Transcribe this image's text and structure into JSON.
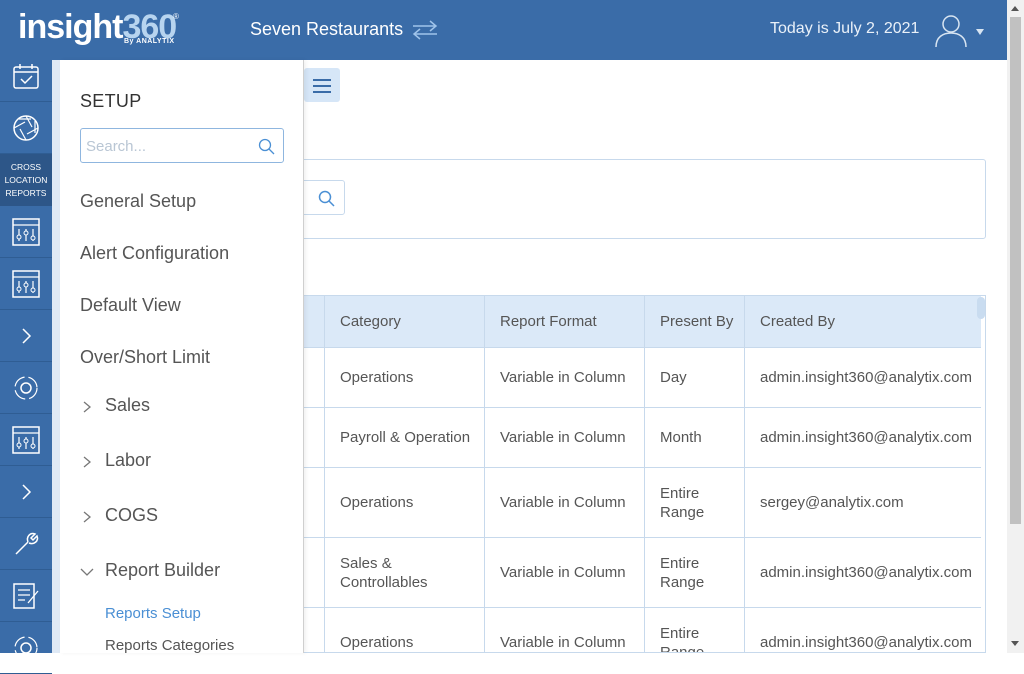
{
  "header": {
    "logo_word": "insight",
    "logo_num": "360",
    "logo_reg": "®",
    "logo_by": "By ANALYTIX",
    "org_name": "Seven Restaurants",
    "today": "Today is July 2, 2021"
  },
  "rail": {
    "cross_location": "CROSS LOCATION REPORTS"
  },
  "setup": {
    "title": "SETUP",
    "search_placeholder": "Search...",
    "items": [
      "General Setup",
      "Alert Configuration",
      "Default View",
      "Over/Short Limit"
    ],
    "groups": [
      {
        "label": "Sales",
        "expanded": false
      },
      {
        "label": "Labor",
        "expanded": false
      },
      {
        "label": "COGS",
        "expanded": false
      },
      {
        "label": "Report Builder",
        "expanded": true
      }
    ],
    "report_builder_items": [
      {
        "label": "Reports Setup",
        "active": true
      },
      {
        "label": "Reports Categories",
        "active": false
      }
    ]
  },
  "table": {
    "headers": [
      "Category",
      "Report Format",
      "Present By",
      "Created By"
    ],
    "rows": [
      [
        "Operations",
        "Variable in Column",
        "Day",
        "admin.insight360@analytix.com"
      ],
      [
        "Payroll & Operation",
        "Variable in Column",
        "Month",
        "admin.insight360@analytix.com"
      ],
      [
        "Operations",
        "Variable in Column",
        "Entire Range",
        "sergey@analytix.com"
      ],
      [
        "Sales & Controllables",
        "Variable in Column",
        "Entire Range",
        "admin.insight360@analytix.com"
      ],
      [
        "Operations",
        "Variable in Column",
        "Entire Range",
        "admin.insight360@analytix.com"
      ]
    ]
  },
  "colors": {
    "brand_blue": "#3a6ca8",
    "header_row": "#dbe9f8",
    "active_link": "#4a8fd4"
  }
}
